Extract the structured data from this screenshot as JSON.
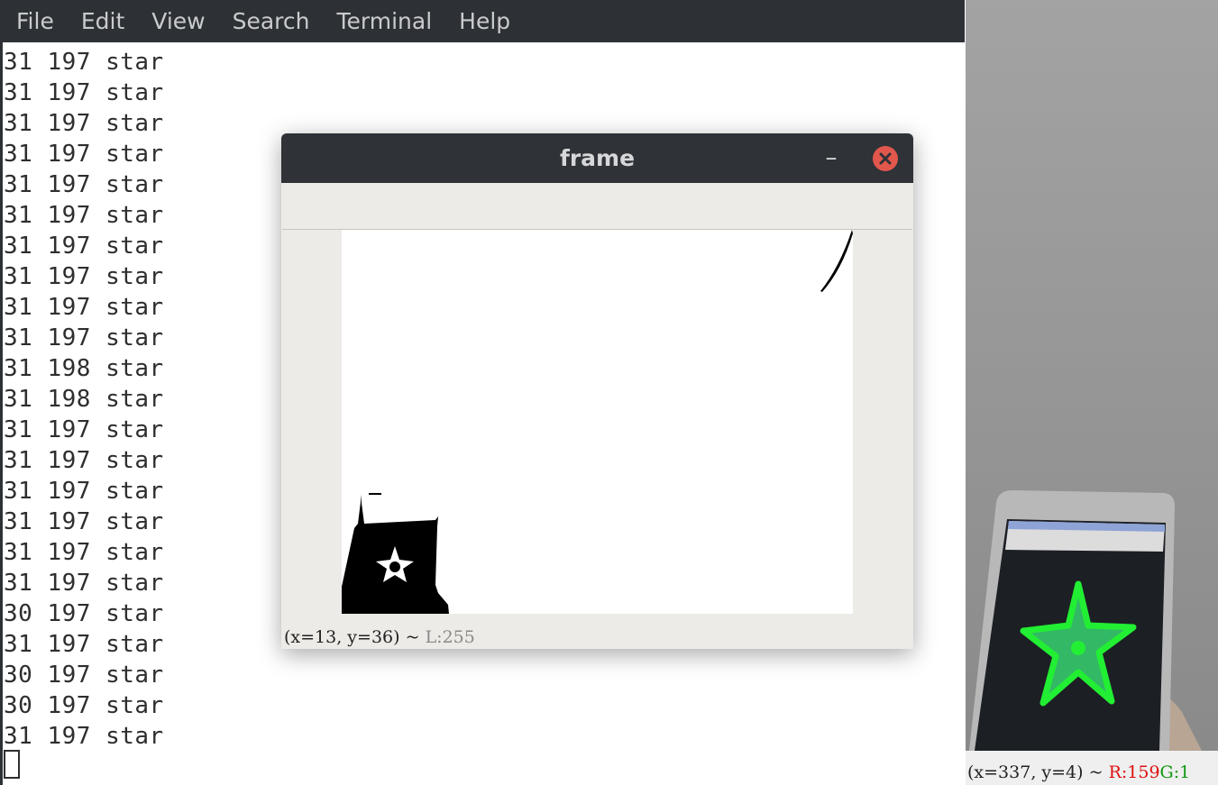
{
  "terminal": {
    "menu": [
      "File",
      "Edit",
      "View",
      "Search",
      "Terminal",
      "Help"
    ],
    "lines": [
      "31 197 star",
      "31 197 star",
      "31 197 star",
      "31 197 star",
      "31 197 star",
      "31 197 star",
      "31 197 star",
      "31 197 star",
      "31 197 star",
      "31 197 star",
      "31 198 star",
      "31 198 star",
      "31 197 star",
      "31 197 star",
      "31 197 star",
      "31 197 star",
      "31 197 star",
      "31 197 star",
      "30 197 star",
      "31 197 star",
      "30 197 star",
      "30 197 star",
      "31 197 star"
    ]
  },
  "frame_window": {
    "title": "frame",
    "minimize_symbol": "–",
    "status_coords": "(x=13, y=36) ~",
    "status_value": "L:255"
  },
  "camera": {
    "status_coords": "(x=337, y=4) ~",
    "status_r": "R:159",
    "status_g": "G:1"
  },
  "colors": {
    "titlebar": "#2d3035",
    "close_button": "#e2574c",
    "star_outline": "#22ee33",
    "star_fill": "#33bb66"
  }
}
